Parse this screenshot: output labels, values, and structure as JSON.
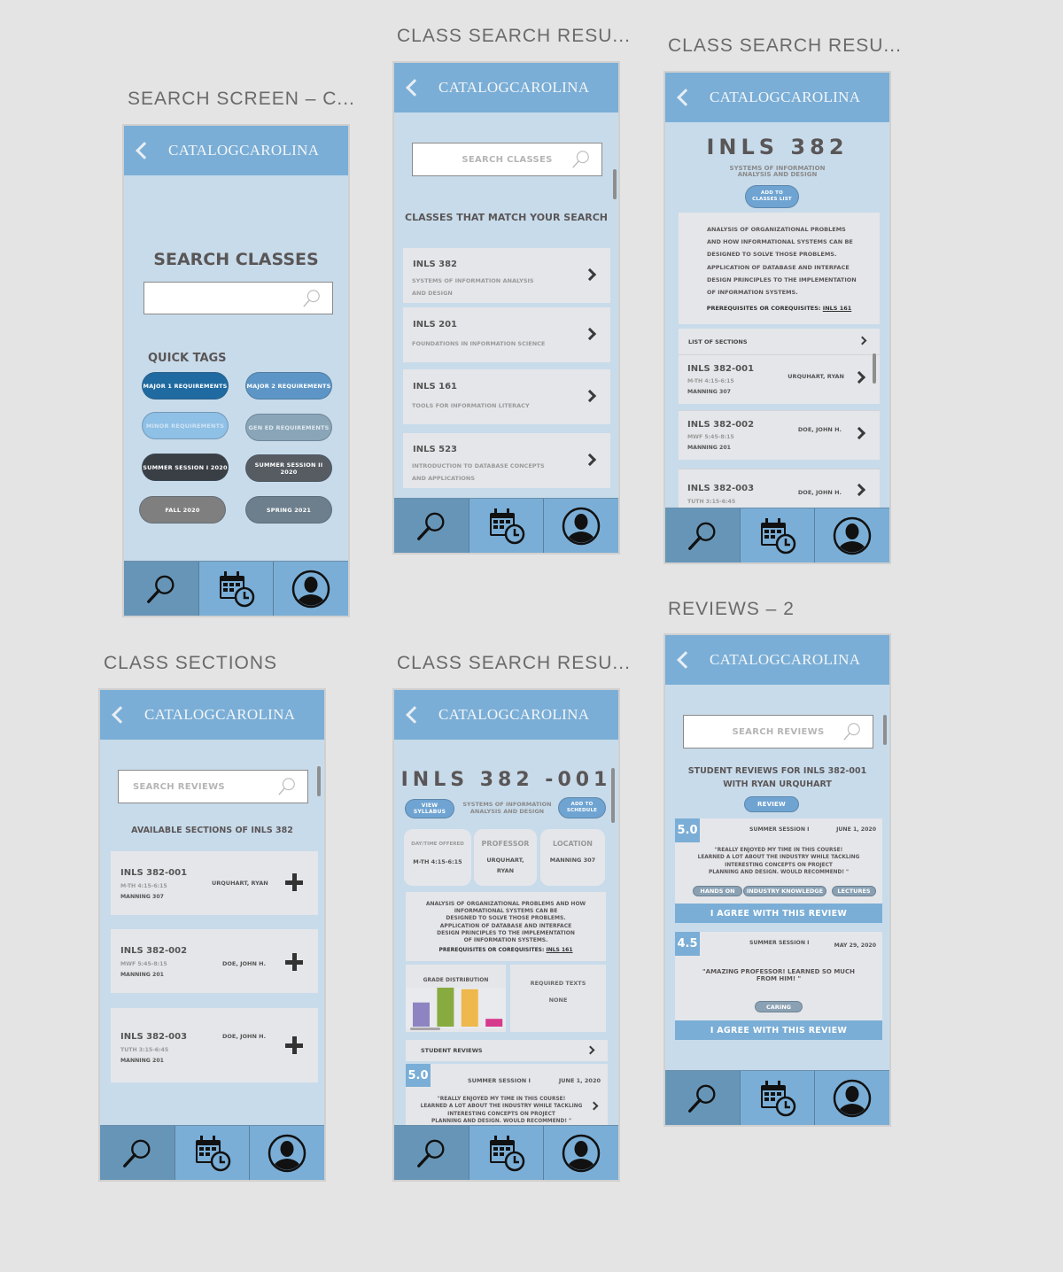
{
  "app": {
    "brand": "CATALOGCAROLINA",
    "back_icon": "chevron-left-icon",
    "nav_tabs": [
      {
        "name": "search",
        "icon": "magnifier-icon"
      },
      {
        "name": "schedule",
        "icon": "calendar-clock-icon"
      },
      {
        "name": "profile",
        "icon": "user-avatar-icon"
      }
    ],
    "colors": {
      "header": "#7aaed6",
      "background": "#c8dbea",
      "card": "#e5e6ea",
      "nav_active": "#6795b7",
      "canvas": "#e4e4e4"
    }
  },
  "frames": {
    "search_screen": {
      "label": "SEARCH SCREEN – C...",
      "heading": "SEARCH CLASSES",
      "search_value": "",
      "quick_tags_heading": "QUICK TAGS",
      "quick_tags": [
        {
          "label": "MAJOR 1 REQUIREMENTS",
          "color": "#1f6aa0"
        },
        {
          "label": "MAJOR 2 REQUIREMENTS",
          "color": "#5d96c6"
        },
        {
          "label": "MINOR REQUIREMENTS",
          "color": "#8fc0e6"
        },
        {
          "label": "GEN ED REQUIREMENTS",
          "color": "#8aa5b8"
        },
        {
          "label": "SUMMER SESSION I 2020",
          "color": "#3a3f45"
        },
        {
          "label": "SUMMER SESSION II 2020",
          "color": "#575c63"
        },
        {
          "label": "FALL 2020",
          "color": "#7f7f80"
        },
        {
          "label": "SPRING 2021",
          "color": "#6d7f8c"
        }
      ]
    },
    "class_results": {
      "label": "CLASS SEARCH RESU...",
      "search_placeholder": "SEARCH CLASSES",
      "heading": "CLASSES THAT MATCH YOUR SEARCH",
      "classes": [
        {
          "code": "INLS 382",
          "title_l1": "SYSTEMS OF INFORMATION ANALYSIS",
          "title_l2": "AND DESIGN"
        },
        {
          "code": "INLS 201",
          "title_l1": "FOUNDATIONS IN INFORMATION SCIENCE",
          "title_l2": ""
        },
        {
          "code": "INLS 161",
          "title_l1": "TOOLS FOR INFORMATION LITERACY",
          "title_l2": ""
        },
        {
          "code": "INLS 523",
          "title_l1": "INTRODUCTION TO DATABASE CONCEPTS",
          "title_l2": "AND APPLICATIONS"
        }
      ]
    },
    "class_detail": {
      "label": "CLASS SEARCH RESU...",
      "code": "INLS 382",
      "title_l1": "SYSTEMS OF INFORMATION",
      "title_l2": "ANALYSIS AND DESIGN",
      "add_button_l1": "ADD TO",
      "add_button_l2": "CLASSES LIST",
      "description_lines": [
        "ANALYSIS OF ORGANIZATIONAL PROBLEMS",
        "AND HOW INFORMATIONAL SYSTEMS CAN BE",
        "DESIGNED TO SOLVE THOSE PROBLEMS.",
        "APPLICATION OF DATABASE AND INTERFACE",
        "DESIGN PRINCIPLES TO THE IMPLEMENTATION",
        "OF INFORMATION SYSTEMS."
      ],
      "prereq_label": "PREREQUISITES OR COREQUISITES:",
      "prereq_link": "INLS 161",
      "sections_header": "LIST OF SECTIONS",
      "sections": [
        {
          "code": "INLS 382-001",
          "time": "M-TH 4:15-6:15",
          "room": "MANNING 307",
          "instructor": "URQUHART, RYAN"
        },
        {
          "code": "INLS 382-002",
          "time": "MWF 5:45-8:15",
          "room": "MANNING 201",
          "instructor": "DOE, JOHN H."
        },
        {
          "code": "INLS 382-003",
          "time": "TUTH 3:15-6:45",
          "room": "",
          "instructor": "DOE, JOHN H."
        }
      ]
    },
    "reviews_2": {
      "label": "REVIEWS – 2",
      "search_placeholder": "SEARCH REVIEWS",
      "heading_l1": "STUDENT REVIEWS FOR INLS 382-001",
      "heading_l2": "WITH RYAN URQUHART",
      "review_button": "REVIEW",
      "agree_label": "I AGREE WITH THIS REVIEW",
      "reviews": [
        {
          "score": "5.0",
          "session": "SUMMER SESSION I",
          "date": "JUNE 1, 2020",
          "quote_lines": [
            "\"REALLY ENJOYED MY TIME IN THIS COURSE!",
            "LEARNED A LOT ABOUT THE INDUSTRY WHILE TACKLING",
            "INTERESTING CONCEPTS ON PROJECT",
            "PLANNING AND DESIGN. WOULD RECOMMEND! \""
          ],
          "tags": [
            "HANDS ON",
            "INDUSTRY KNOWLEDGE",
            "LECTURES"
          ]
        },
        {
          "score": "4.5",
          "session": "SUMMER SESSION I",
          "date": "MAY 29, 2020",
          "quote_lines": [
            "\"AMAZING PROFESSOR! LEARNED SO MUCH",
            "FROM HIM! \""
          ],
          "tags": [
            "CARING"
          ]
        }
      ]
    },
    "class_sections": {
      "label": "CLASS SECTIONS",
      "search_placeholder": "SEARCH REVIEWS",
      "heading": "AVAILABLE SECTIONS OF INLS 382",
      "sections": [
        {
          "code": "INLS 382-001",
          "time": "M-TH 4:15-6:15",
          "room": "MANNING 307",
          "instructor": "URQUHART, RYAN"
        },
        {
          "code": "INLS 382-002",
          "time": "MWF 5:45-8:15",
          "room": "MANNING 201",
          "instructor": "DOE, JOHN H."
        },
        {
          "code": "INLS 382-003",
          "time": "TUTH 3:15-6:45",
          "room": "MANNING 201",
          "instructor": "DOE, JOHN H."
        }
      ]
    },
    "section_detail": {
      "label": "CLASS SEARCH RESU...",
      "code": "INLS 382 -001",
      "view_syllabus_l1": "VIEW",
      "view_syllabus_l2": "SYLLABUS",
      "title_l1": "SYSTEMS OF INFORMATION",
      "title_l2": "ANALYSIS AND DESIGN",
      "add_schedule_l1": "ADD TO",
      "add_schedule_l2": "SCHEDULE",
      "info": [
        {
          "label": "DAY/TIME OFFERED",
          "value_l1": "M-TH 4:15-6:15",
          "value_l2": ""
        },
        {
          "label": "PROFESSOR",
          "value_l1": "URQUHART,",
          "value_l2": "RYAN"
        },
        {
          "label": "LOCATION",
          "value_l1": "MANNING 307",
          "value_l2": ""
        }
      ],
      "description_lines": [
        "ANALYSIS OF ORGANIZATIONAL PROBLEMS AND HOW",
        "INFORMATIONAL SYSTEMS CAN BE",
        "DESIGNED TO SOLVE THOSE PROBLEMS.",
        "APPLICATION OF DATABASE AND INTERFACE",
        "DESIGN PRINCIPLES TO THE IMPLEMENTATION",
        "OF INFORMATION SYSTEMS."
      ],
      "prereq_label": "PREREQUISITES OR COREQUISITES:",
      "prereq_link": "INLS 161",
      "grade_distribution_label": "GRADE DISTRIBUTION",
      "grade_bars": [
        {
          "relative": 0.62,
          "color": "#8e84c2"
        },
        {
          "relative": 1.0,
          "color": "#88ab3f"
        },
        {
          "relative": 0.96,
          "color": "#eeb84c"
        },
        {
          "relative": 0.2,
          "color": "#d63a8d"
        }
      ],
      "required_texts_label": "REQUIRED TEXTS",
      "required_texts_value": "NONE",
      "student_reviews_label": "STUDENT REVIEWS",
      "review": {
        "score": "5.0",
        "session": "SUMMER SESSION I",
        "date": "JUNE 1, 2020",
        "quote_lines": [
          "\"REALLY ENJOYED MY TIME IN THIS COURSE!",
          "LEARNED A LOT ABOUT THE INDUSTRY WHILE TACKLING",
          "INTERESTING CONCEPTS ON PROJECT",
          "PLANNING AND DESIGN. WOULD RECOMMEND! \""
        ]
      }
    }
  }
}
